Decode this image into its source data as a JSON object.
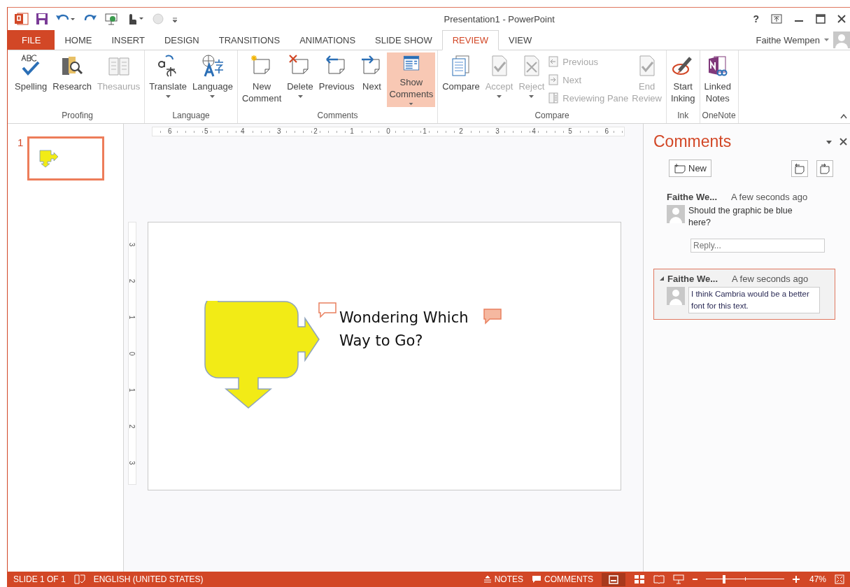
{
  "window": {
    "title": "Presentation1 - PowerPoint",
    "help": "?"
  },
  "tabs": [
    {
      "label": "FILE",
      "kind": "file",
      "selected": false
    },
    {
      "label": "HOME",
      "kind": "tab",
      "selected": false
    },
    {
      "label": "INSERT",
      "kind": "tab",
      "selected": false
    },
    {
      "label": "DESIGN",
      "kind": "tab",
      "selected": false
    },
    {
      "label": "TRANSITIONS",
      "kind": "tab",
      "selected": false
    },
    {
      "label": "ANIMATIONS",
      "kind": "tab",
      "selected": false
    },
    {
      "label": "SLIDE SHOW",
      "kind": "tab",
      "selected": false
    },
    {
      "label": "REVIEW",
      "kind": "tab",
      "selected": true
    },
    {
      "label": "VIEW",
      "kind": "tab",
      "selected": false
    }
  ],
  "user": {
    "name": "Faithe Wempen"
  },
  "ribbon": [
    {
      "name": "Proofing",
      "buttons": [
        {
          "label": "Spelling",
          "kind": "large",
          "disabled": false,
          "dropdown": false,
          "selected": false
        },
        {
          "label": "Research",
          "kind": "large",
          "disabled": false,
          "dropdown": false,
          "selected": false
        },
        {
          "label": "Thesaurus",
          "kind": "large",
          "disabled": true,
          "dropdown": false,
          "selected": false
        }
      ]
    },
    {
      "name": "Language",
      "buttons": [
        {
          "label": "Translate",
          "kind": "large",
          "disabled": false,
          "dropdown": true,
          "selected": false
        },
        {
          "label": "Language",
          "kind": "large",
          "disabled": false,
          "dropdown": true,
          "selected": false
        }
      ]
    },
    {
      "name": "Comments",
      "buttons": [
        {
          "label": "New Comment",
          "kind": "large",
          "disabled": false,
          "dropdown": false,
          "selected": false
        },
        {
          "label": "Delete",
          "kind": "large",
          "disabled": false,
          "dropdown": true,
          "selected": false
        },
        {
          "label": "Previous",
          "kind": "large",
          "disabled": false,
          "dropdown": false,
          "selected": false
        },
        {
          "label": "Next",
          "kind": "large",
          "disabled": false,
          "dropdown": false,
          "selected": false
        },
        {
          "label": "Show Comments",
          "kind": "large",
          "disabled": false,
          "dropdown": true,
          "selected": true
        }
      ]
    },
    {
      "name": "Compare",
      "buttons": [
        {
          "label": "Compare",
          "kind": "large",
          "disabled": false,
          "dropdown": false,
          "selected": false
        },
        {
          "label": "Accept",
          "kind": "large",
          "disabled": true,
          "dropdown": true,
          "selected": false
        },
        {
          "label": "Reject",
          "kind": "large",
          "disabled": true,
          "dropdown": true,
          "selected": false
        },
        {
          "label": "Previous",
          "kind": "small",
          "disabled": true,
          "dropdown": false,
          "selected": false
        },
        {
          "label": "Next",
          "kind": "small",
          "disabled": true,
          "dropdown": false,
          "selected": false
        },
        {
          "label": "Reviewing Pane",
          "kind": "small",
          "disabled": true,
          "dropdown": false,
          "selected": false
        },
        {
          "label": "End Review",
          "kind": "large",
          "disabled": true,
          "dropdown": false,
          "selected": false
        }
      ]
    },
    {
      "name": "Ink",
      "buttons": [
        {
          "label": "Start Inking",
          "kind": "large",
          "disabled": false,
          "dropdown": false,
          "selected": false
        }
      ]
    },
    {
      "name": "OneNote",
      "buttons": [
        {
          "label": "Linked Notes",
          "kind": "large",
          "disabled": false,
          "dropdown": false,
          "selected": false
        }
      ]
    }
  ],
  "thumbnails": [
    {
      "number": "1",
      "selected": true
    }
  ],
  "rulers": {
    "horizontal": [
      "6",
      "5",
      "4",
      "3",
      "2",
      "1",
      "0",
      "1",
      "2",
      "3",
      "4",
      "5",
      "6"
    ],
    "vertical": [
      "3",
      "2",
      "1",
      "0",
      "1",
      "2",
      "3"
    ]
  },
  "slide": {
    "text": "Wondering Which Way to Go?"
  },
  "comments_pane": {
    "title": "Comments",
    "new_button": "New",
    "comments": [
      {
        "author": "Faithe We...",
        "time": "A few seconds ago",
        "text": "Should the graphic be blue here?",
        "reply_placeholder": "Reply...",
        "selected": false
      },
      {
        "author": "Faithe We...",
        "time": "A few seconds ago",
        "text": "I think Cambria would be a better font for this text.",
        "selected": true
      }
    ]
  },
  "status_bar": {
    "slide": "SLIDE 1 OF 1",
    "language": "ENGLISH (UNITED STATES)",
    "notes": "NOTES",
    "comments": "COMMENTS",
    "zoom": {
      "level": 0.23,
      "reading": "47%"
    }
  }
}
